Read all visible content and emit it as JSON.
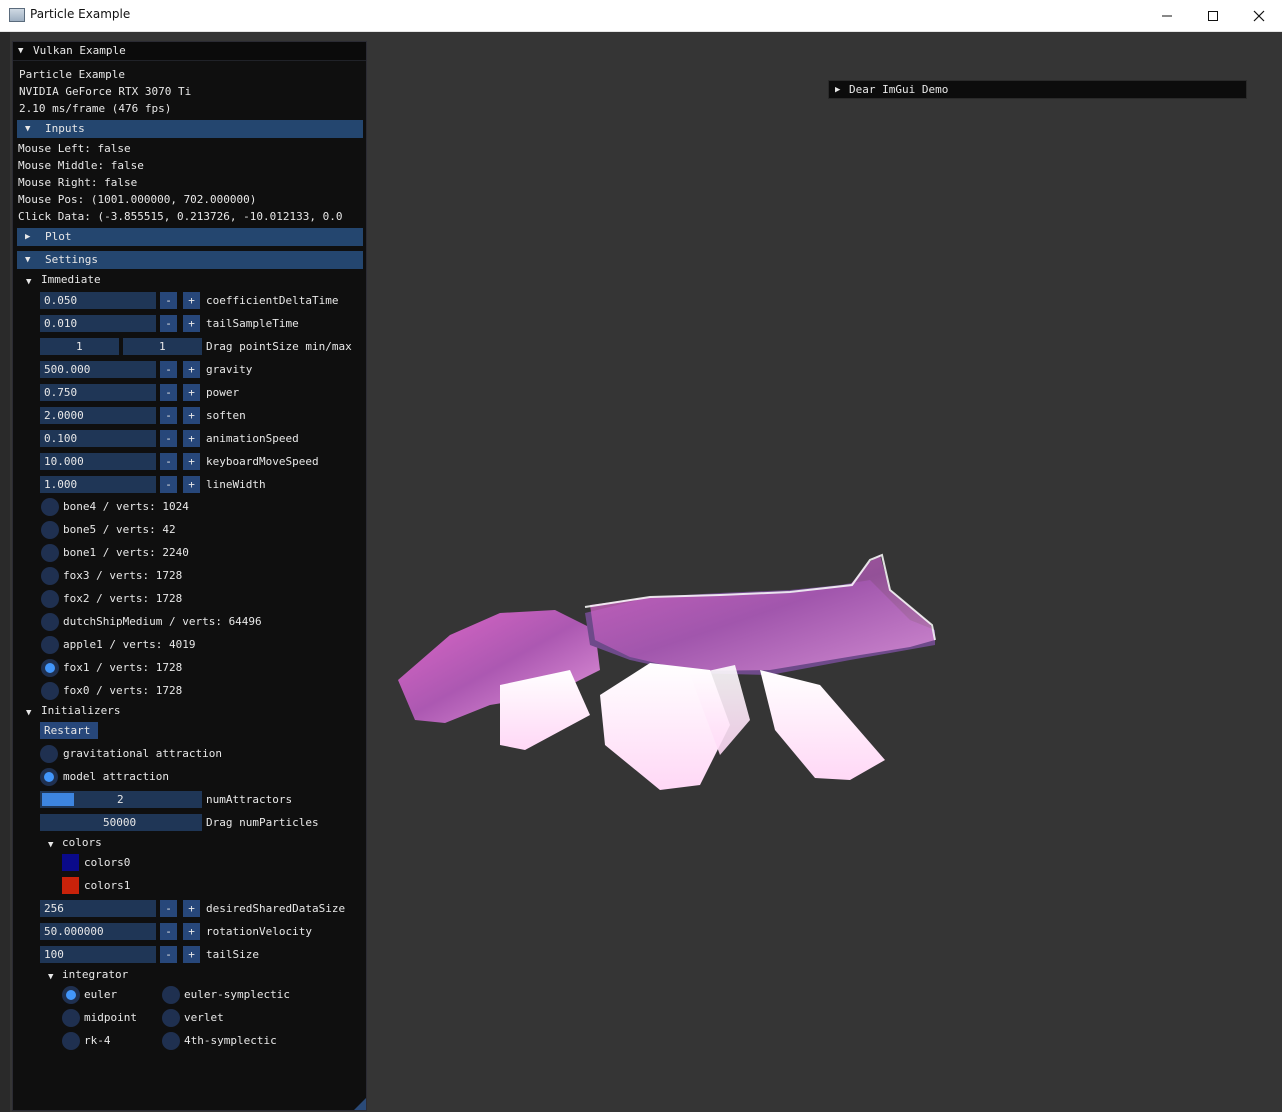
{
  "window": {
    "title": "Particle Example",
    "minimize_icon": "minimize-icon",
    "maximize_icon": "maximize-icon",
    "close_icon": "close-icon"
  },
  "panel": {
    "title": "Vulkan Example",
    "info": [
      "Particle Example",
      "NVIDIA GeForce RTX 3070 Ti",
      "2.10 ms/frame (476 fps)"
    ],
    "inputs": {
      "header": "Inputs",
      "lines": [
        "Mouse Left: false",
        "Mouse Middle: false",
        "Mouse Right: false",
        "Mouse Pos: (1001.000000, 702.000000)",
        "Click Data: (-3.855515, 0.213726, -10.012133, 0.0"
      ]
    },
    "plot_header": "Plot",
    "settings_header": "Settings",
    "immediate": {
      "label": "Immediate",
      "coefficientDeltaTime": {
        "value": "0.050",
        "label": "coefficientDeltaTime"
      },
      "tailSampleTime": {
        "value": "0.010",
        "label": "tailSampleTime"
      },
      "pointSize": {
        "min": "1",
        "max": "1",
        "label": "Drag pointSize min/max"
      },
      "gravity": {
        "value": "500.000",
        "label": "gravity"
      },
      "power": {
        "value": "0.750",
        "label": "power"
      },
      "soften": {
        "value": "2.0000",
        "label": "soften"
      },
      "animationSpeed": {
        "value": "0.100",
        "label": "animationSpeed"
      },
      "keyboardMoveSpeed": {
        "value": "10.000",
        "label": "keyboardMoveSpeed"
      },
      "lineWidth": {
        "value": "1.000",
        "label": "lineWidth"
      },
      "models": [
        {
          "label": "bone4 / verts: 1024",
          "selected": false
        },
        {
          "label": "bone5 / verts: 42",
          "selected": false
        },
        {
          "label": "bone1 / verts: 2240",
          "selected": false
        },
        {
          "label": "fox3 / verts: 1728",
          "selected": false
        },
        {
          "label": "fox2 / verts: 1728",
          "selected": false
        },
        {
          "label": "dutchShipMedium / verts: 64496",
          "selected": false
        },
        {
          "label": "apple1 / verts: 4019",
          "selected": false
        },
        {
          "label": "fox1 / verts: 1728",
          "selected": true
        },
        {
          "label": "fox0 / verts: 1728",
          "selected": false
        }
      ]
    },
    "initializers": {
      "label": "Initializers",
      "restart": "Restart",
      "gravitational": "gravitational attraction",
      "model_attraction": "model attraction",
      "numAttractors": {
        "value": "2",
        "label": "numAttractors",
        "fraction": 0.2
      },
      "numParticles": {
        "value": "50000",
        "label": "Drag numParticles"
      },
      "colors": {
        "label": "colors",
        "colors0": {
          "label": "colors0",
          "color": "#0a0a8a"
        },
        "colors1": {
          "label": "colors1",
          "color": "#c8220a"
        }
      },
      "desiredSharedDataSize": {
        "value": "256",
        "label": "desiredSharedDataSize"
      },
      "rotationVelocity": {
        "value": "50.000000",
        "label": "rotationVelocity"
      },
      "tailSize": {
        "value": "100",
        "label": "tailSize"
      },
      "integrator": {
        "label": "integrator",
        "euler": "euler",
        "euler_symplectic": "euler-symplectic",
        "midpoint": "midpoint",
        "verlet": "verlet",
        "rk4": "rk-4",
        "symplectic4": "4th-symplectic",
        "selected": "euler"
      }
    },
    "minus": "-",
    "plus": "+"
  },
  "demo_window": {
    "title": "Dear ImGui Demo"
  },
  "colors": {
    "accent": "#4296fa",
    "header": "#24466f",
    "frame": "#1f3656",
    "button": "#27477a"
  }
}
